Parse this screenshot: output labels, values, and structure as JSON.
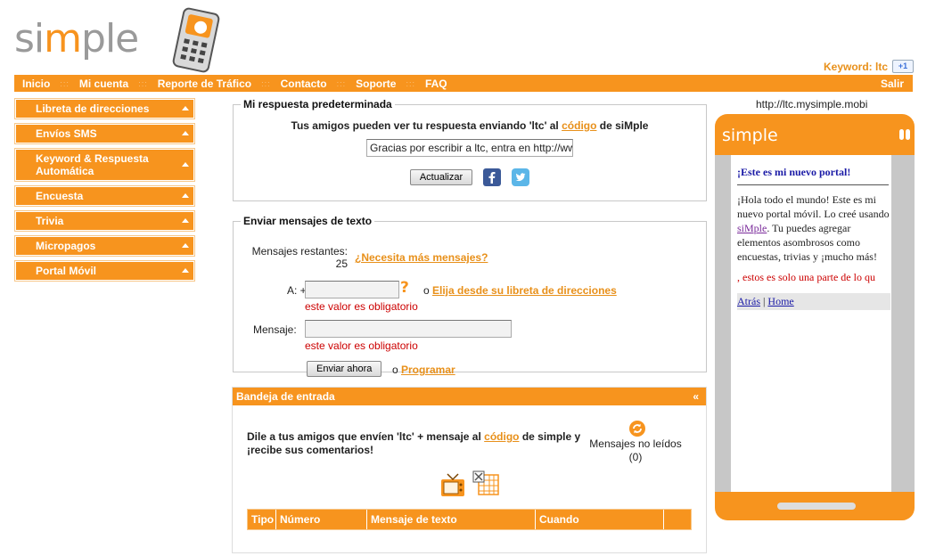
{
  "brand": {
    "logo_pre": "si",
    "logo_m": "m",
    "logo_post": "ple"
  },
  "header": {
    "keyword": "Keyword: ltc",
    "gplus": "+1"
  },
  "nav": {
    "items": [
      "Inicio",
      "Mi cuenta",
      "Reporte de Tráfico",
      "Contacto",
      "Soporte",
      "FAQ"
    ],
    "separator": ":::",
    "logout": "Salir"
  },
  "sidebar": {
    "items": [
      {
        "label": "Libreta de direcciones"
      },
      {
        "label": "Envíos SMS"
      },
      {
        "label": "Keyword & Respuesta Automática"
      },
      {
        "label": "Encuesta"
      },
      {
        "label": "Trivia"
      },
      {
        "label": "Micropagos"
      },
      {
        "label": "Portal Móvil"
      }
    ]
  },
  "default_reply": {
    "legend": "Mi respuesta predeterminada",
    "desc_pre": "Tus amigos pueden ver tu respuesta enviando 'ltc' al",
    "desc_link": "código",
    "desc_post": "de siMple",
    "value": "Gracias por escribir a ltc, entra en http://ww",
    "update_button": "Actualizar"
  },
  "send": {
    "legend": "Enviar mensajes de texto",
    "remaining_label": "Mensajes restantes:",
    "remaining_value": "25",
    "need_more": "¿Necesita más mensajes?",
    "to_label": "A: +",
    "or": "o",
    "choose_link": "Elija desde su libreta de direcciones",
    "required": "este valor es obligatorio",
    "message_label": "Mensaje:",
    "send_button": "Enviar ahora",
    "schedule_link": "Programar"
  },
  "inbox": {
    "title": "Bandeja de entrada",
    "collapse": "«",
    "text_pre": "Dile a tus amigos que envíen 'ltc' + mensaje al",
    "text_link": "código",
    "text_post": "de simple y",
    "text_line2": "¡recibe sus comentarios!",
    "unread_label": "Mensajes no leídos",
    "unread_count": "(0)",
    "columns": [
      "Tipo",
      "Número",
      "Mensaje de texto",
      "Cuando",
      ""
    ]
  },
  "phone": {
    "url": "http://ltc.mysimple.mobi",
    "logo": "simple",
    "title": "¡Este es mi nuevo portal!",
    "body_pre": "¡Hola todo el mundo! Este es mi nuevo portal móvil. Lo creé usando",
    "body_link": "siMple",
    "body_post": ". Tu puedes agregar elementos asombrosos como encuestas, trivias y ¡mucho más!",
    "ticker": ", estos es solo una parte de lo qu",
    "back": "Atrás",
    "divider": "|",
    "home": "Home"
  },
  "colors": {
    "accent": "#f7941e",
    "link": "#e8901a",
    "error": "#cc0000"
  }
}
